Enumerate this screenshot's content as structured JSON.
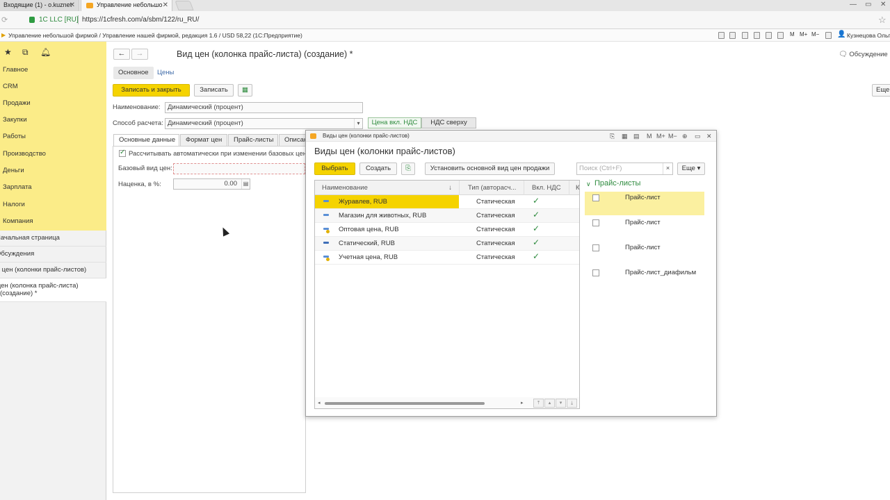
{
  "browser": {
    "tabs": [
      {
        "label": "Входящие (1) - o.kuznet"
      },
      {
        "label": "Управление небольшо"
      }
    ],
    "site": "1C LLC [RU]",
    "url": "https://1cfresh.com/a/sbm/122/ru_RU/"
  },
  "app": {
    "title": "Управление небольшой фирмой / Управление нашей фирмой, редакция 1.6 / USD 58,22   (1С:Предприятие)",
    "user": "Кузнецова Ольга"
  },
  "sidebar": {
    "items": [
      {
        "label": "Главное"
      },
      {
        "label": "CRM"
      },
      {
        "label": "Продажи"
      },
      {
        "label": "Закупки"
      },
      {
        "label": "Работы"
      },
      {
        "label": "Производство"
      },
      {
        "label": "Деньги"
      },
      {
        "label": "Зарплата"
      },
      {
        "label": "Налоги"
      },
      {
        "label": "Компания"
      }
    ],
    "open_windows": [
      {
        "label": "Начальная страница"
      },
      {
        "label": "Обсуждения"
      },
      {
        "label": "Виды цен (колонки прайс-листов)"
      },
      {
        "label": "Вид цен (колонка прайс-листа) (создание) *"
      }
    ]
  },
  "form": {
    "title": "Вид цен (колонка прайс-листа) (создание) *",
    "discuss": "Обсуждение",
    "sections": [
      "Основное",
      "Цены"
    ],
    "save_close": "Записать и закрыть",
    "save": "Записать",
    "more": "Еще",
    "name_label": "Наименование:",
    "name_value": "Динамический (процент)",
    "method_label": "Способ расчета:",
    "method_value": "Динамический (процент)",
    "vat_incl": "Цена вкл. НДС",
    "vat_top": "НДС сверху",
    "tabs": [
      "Основные данные",
      "Формат цен",
      "Прайс-листы",
      "Описание"
    ],
    "auto_calc": "Рассчитывать автоматически при изменении базовых цен",
    "base_label": "Базовый вид цен:",
    "markup_label": "Наценка, в %:",
    "markup_value": "0.00"
  },
  "dialog": {
    "window_title": "Виды цен (колонки прайс-листов)",
    "heading": "Виды цен (колонки прайс-листов)",
    "select": "Выбрать",
    "create": "Создать",
    "set_main": "Установить основной вид цен продажи",
    "search_placeholder": "Поиск (Ctrl+F)",
    "more": "Еще",
    "columns": {
      "name": "Наименование",
      "type": "Тип (авторасч...",
      "vat": "Вкл. НДС"
    },
    "rows": [
      {
        "name": "Журавлев, RUB",
        "type": "Статическая",
        "vat": true,
        "selected": true,
        "icon_color": "#5a8fd6",
        "mark": false
      },
      {
        "name": "Магазин для животных, RUB",
        "type": "Статическая",
        "vat": true,
        "selected": false,
        "icon_color": "#5a8fd6",
        "mark": false
      },
      {
        "name": "Оптовая цена, RUB",
        "type": "Статическая",
        "vat": true,
        "selected": false,
        "icon_color": "#5a8fd6",
        "mark": true
      },
      {
        "name": "Статический, RUB",
        "type": "Статическая",
        "vat": true,
        "selected": false,
        "icon_color": "#3f6fb8",
        "mark": false
      },
      {
        "name": "Учетная цена, RUB",
        "type": "Статическая",
        "vat": true,
        "selected": false,
        "icon_color": "#5a8fd6",
        "mark": true
      }
    ],
    "pricelists_header": "Прайс-листы",
    "pricelists": [
      {
        "name": "Прайс-лист",
        "checked": false,
        "selected": true
      },
      {
        "name": "Прайс-лист",
        "checked": false,
        "selected": false
      },
      {
        "name": "Прайс-лист",
        "checked": false,
        "selected": false
      },
      {
        "name": "Прайс-лист_диафильм",
        "checked": false,
        "selected": false
      }
    ]
  },
  "colors": {
    "accent": "#f5d300",
    "panel": "#fbec88",
    "link": "#3d6aa8",
    "green": "#2e8b3e"
  }
}
